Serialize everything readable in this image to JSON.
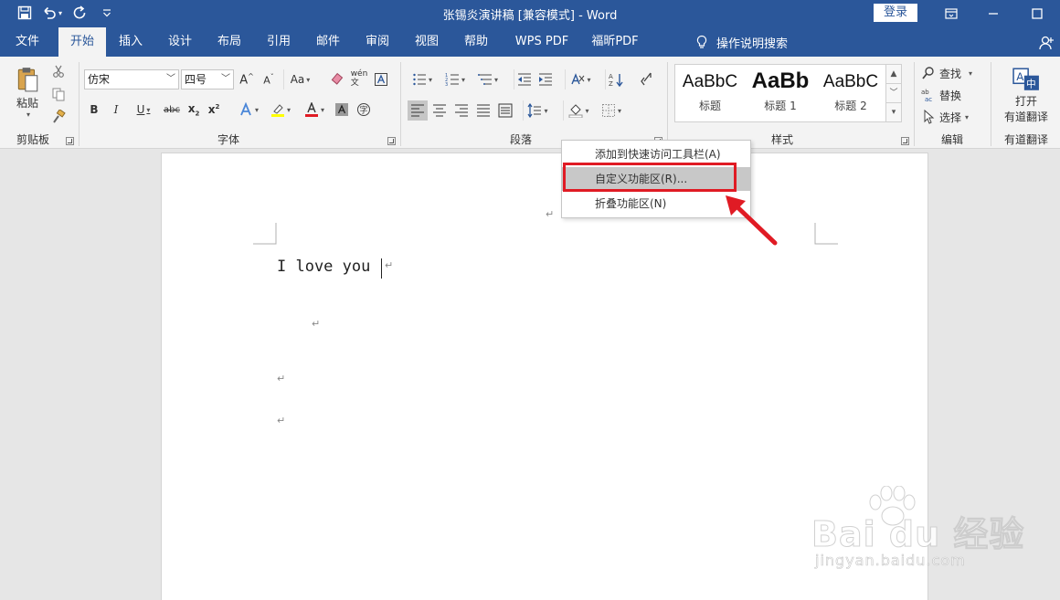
{
  "window": {
    "title": "张锡炎演讲稿 [兼容模式] - Word",
    "login_label": "登录"
  },
  "tabs": [
    "文件",
    "开始",
    "插入",
    "设计",
    "布局",
    "引用",
    "邮件",
    "审阅",
    "视图",
    "帮助",
    "WPS PDF",
    "福昕PDF"
  ],
  "active_tab": "开始",
  "tell_me": "操作说明搜索",
  "ribbon": {
    "clipboard": {
      "paste_label": "粘贴",
      "group_label": "剪贴板"
    },
    "font": {
      "font_name": "仿宋",
      "font_size": "四号",
      "change_case": "Aa",
      "group_label": "字体"
    },
    "paragraph": {
      "group_label": "段落"
    },
    "styles": {
      "items": [
        {
          "sample": "AaBbC",
          "name": "标题"
        },
        {
          "sample": "AaBb",
          "name": "标题 1"
        },
        {
          "sample": "AaBbC",
          "name": "标题 2"
        }
      ],
      "group_label": "样式"
    },
    "editing": {
      "find": "查找",
      "replace": "替换",
      "select": "选择",
      "group_label": "编辑"
    },
    "youdao": {
      "open_label_1": "打开",
      "open_label_2": "有道翻译",
      "group_label": "有道翻译"
    }
  },
  "document": {
    "text": "I love you"
  },
  "context_menu": {
    "items": [
      "添加到快速访问工具栏(A)",
      "自定义功能区(R)...",
      "折叠功能区(N)"
    ],
    "highlighted_index": 1
  },
  "watermark": {
    "main": "Bai du 经验",
    "sub": "jingyan.baidu.com"
  },
  "colors": {
    "accent": "#2b579a",
    "highlight": "#e01b24"
  }
}
